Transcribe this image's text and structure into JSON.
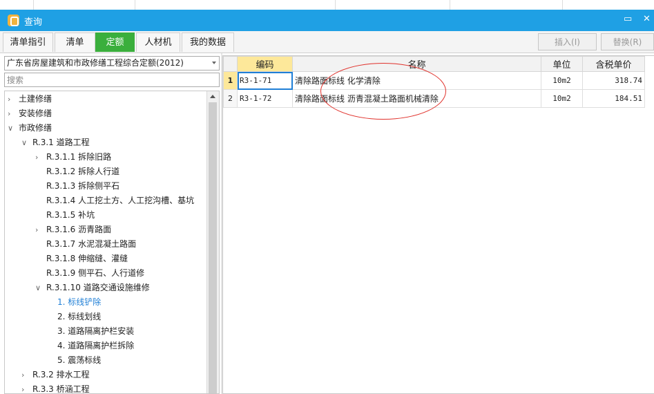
{
  "window": {
    "title": "查询",
    "maximize_glyph": "▭",
    "close_glyph": "✕"
  },
  "tabs": [
    {
      "label": "清单指引",
      "active": false
    },
    {
      "label": "清单",
      "active": false
    },
    {
      "label": "定额",
      "active": true
    },
    {
      "label": "人材机",
      "active": false
    },
    {
      "label": "我的数据",
      "active": false
    }
  ],
  "actions": {
    "insert_label": "插入(I)",
    "replace_label": "替换(R)"
  },
  "left": {
    "dropdown_value": "广东省房屋建筑和市政修缮工程综合定额(2012)",
    "search_placeholder": "搜索",
    "tree": [
      {
        "label": "土建修缮",
        "level": 0,
        "arrow": "collapsed"
      },
      {
        "label": "安装修缮",
        "level": 0,
        "arrow": "collapsed"
      },
      {
        "label": "市政修缮",
        "level": 0,
        "arrow": "expanded"
      },
      {
        "label": "R.3.1 道路工程",
        "level": 1,
        "arrow": "expanded"
      },
      {
        "label": "R.3.1.1 拆除旧路",
        "level": 2,
        "arrow": "collapsed"
      },
      {
        "label": "R.3.1.2 拆除人行道",
        "level": 2,
        "arrow": "none"
      },
      {
        "label": "R.3.1.3 拆除侧平石",
        "level": 2,
        "arrow": "none"
      },
      {
        "label": "R.3.1.4 人工挖土方、人工挖沟槽、基坑",
        "level": 2,
        "arrow": "none"
      },
      {
        "label": "R.3.1.5 补坑",
        "level": 2,
        "arrow": "none"
      },
      {
        "label": "R.3.1.6 沥青路面",
        "level": 2,
        "arrow": "collapsed"
      },
      {
        "label": "R.3.1.7 水泥混凝土路面",
        "level": 2,
        "arrow": "none"
      },
      {
        "label": "R.3.1.8 伸缩缝、灌缝",
        "level": 2,
        "arrow": "none"
      },
      {
        "label": "R.3.1.9 侧平石、人行道修",
        "level": 2,
        "arrow": "none"
      },
      {
        "label": "R.3.1.10 道路交通设施维修",
        "level": 2,
        "arrow": "expanded"
      },
      {
        "label": "1. 标线铲除",
        "level": 3,
        "arrow": "none",
        "selected": true
      },
      {
        "label": "2. 标线划线",
        "level": 3,
        "arrow": "none"
      },
      {
        "label": "3. 道路隔离护栏安装",
        "level": 3,
        "arrow": "none"
      },
      {
        "label": "4. 道路隔离护栏拆除",
        "level": 3,
        "arrow": "none"
      },
      {
        "label": "5. 震荡标线",
        "level": 3,
        "arrow": "none"
      },
      {
        "label": "R.3.2 排水工程",
        "level": 1,
        "arrow": "collapsed"
      },
      {
        "label": "R.3.3 桥涵工程",
        "level": 1,
        "arrow": "collapsed"
      }
    ]
  },
  "table": {
    "columns": [
      "",
      "编码",
      "名称",
      "单位",
      "含税单价"
    ],
    "rows": [
      {
        "no": "1",
        "code": "R3-1-71",
        "name": "清除路面标线 化学清除",
        "unit": "10m2",
        "price": "318.74"
      },
      {
        "no": "2",
        "code": "R3-1-72",
        "name": "清除路面标线 沥青混凝土路面机械清除",
        "unit": "10m2",
        "price": "184.51"
      }
    ]
  },
  "colors": {
    "titlebar": "#1fa0e4",
    "active_tab": "#3aaf3c",
    "selected_node": "#1f7fd6",
    "annotation": "#e0302a",
    "highlight": "#fde89a"
  }
}
